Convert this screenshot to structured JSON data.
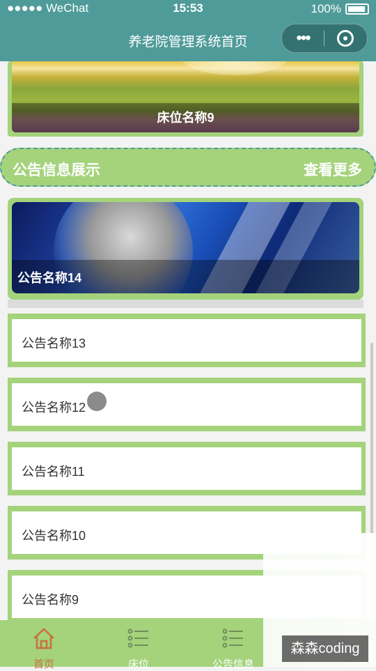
{
  "status_bar": {
    "carrier": "●●●●● WeChat",
    "time": "15:53",
    "battery": "100%"
  },
  "nav": {
    "title": "养老院管理系统首页"
  },
  "bed_card": {
    "caption": "床位名称9"
  },
  "notice_section": {
    "title": "公告信息展示",
    "more": "查看更多"
  },
  "featured_notice": {
    "caption": "公告名称14"
  },
  "notices": [
    {
      "title": "公告名称13"
    },
    {
      "title": "公告名称12"
    },
    {
      "title": "公告名称11"
    },
    {
      "title": "公告名称10"
    },
    {
      "title": "公告名称9"
    }
  ],
  "tabbar": [
    {
      "label": "首页",
      "icon": "home-icon",
      "active": true
    },
    {
      "label": "床位",
      "icon": "list-icon",
      "active": false
    },
    {
      "label": "公告信息",
      "icon": "list-icon",
      "active": false
    }
  ],
  "watermark": "森森coding",
  "colors": {
    "nav": "#4f9b9a",
    "accent_green": "#a4d37c",
    "active_tab": "#c8703a"
  }
}
